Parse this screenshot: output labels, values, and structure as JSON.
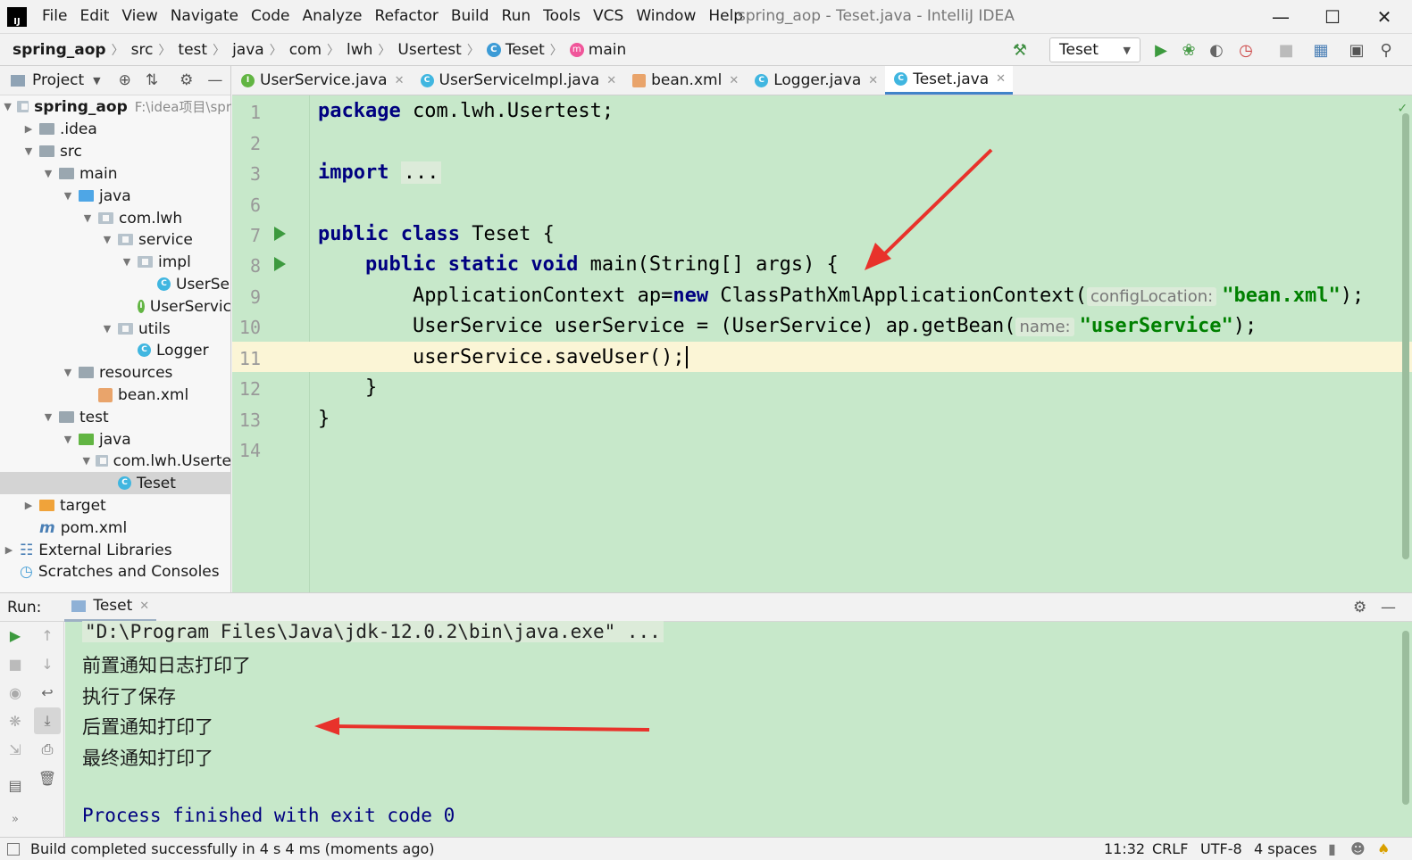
{
  "app": {
    "title": "spring_aop - Teset.java - IntelliJ IDEA"
  },
  "menu": [
    "File",
    "Edit",
    "View",
    "Navigate",
    "Code",
    "Analyze",
    "Refactor",
    "Build",
    "Run",
    "Tools",
    "VCS",
    "Window",
    "Help"
  ],
  "breadcrumb": [
    "spring_aop",
    "src",
    "test",
    "java",
    "com",
    "lwh",
    "Usertest",
    "Teset",
    "main"
  ],
  "run_config": "Teset",
  "project_panel": {
    "title": "Project",
    "tree": [
      {
        "label": "spring_aop",
        "extra": "F:\\idea项目\\spr"
      },
      {
        "label": ".idea"
      },
      {
        "label": "src"
      },
      {
        "label": "main"
      },
      {
        "label": "java"
      },
      {
        "label": "com.lwh"
      },
      {
        "label": "service"
      },
      {
        "label": "impl"
      },
      {
        "label": "UserSe"
      },
      {
        "label": "UserServic"
      },
      {
        "label": "utils"
      },
      {
        "label": "Logger"
      },
      {
        "label": "resources"
      },
      {
        "label": "bean.xml"
      },
      {
        "label": "test"
      },
      {
        "label": "java"
      },
      {
        "label": "com.lwh.Userte"
      },
      {
        "label": "Teset"
      },
      {
        "label": "target"
      },
      {
        "label": "pom.xml"
      },
      {
        "label": "External Libraries"
      },
      {
        "label": "Scratches and Consoles"
      }
    ]
  },
  "tabs": [
    "UserService.java",
    "UserServiceImpl.java",
    "bean.xml",
    "Logger.java",
    "Teset.java"
  ],
  "editor": {
    "line_numbers": [
      "1",
      "2",
      "3",
      "6",
      "7",
      "8",
      "9",
      "10",
      "11",
      "12",
      "13",
      "14"
    ],
    "code": {
      "l1_kw": "package",
      "l1_rest": " com.lwh.Usertest;",
      "l3_kw": "import",
      "l3_fold": "...",
      "l7_kw": "public class",
      "l7_rest": " Teset {",
      "l8_kw": "public static void",
      "l8_rest": " main(String[] args) {",
      "l9_a": "ApplicationContext ap=",
      "l9_kw": "new",
      "l9_b": " ClassPathXmlApplicationContext(",
      "l9_hint": "configLocation:",
      "l9_str": "\"bean.xml\"",
      "l9_c": ");",
      "l10_a": "UserService userService = (UserService) ap.getBean(",
      "l10_hint": "name:",
      "l10_str": "\"userService\"",
      "l10_c": ");",
      "l11": "userService.saveUser();",
      "l12": "}",
      "l13": "}"
    }
  },
  "run": {
    "label": "Run:",
    "tab": "Teset",
    "console": {
      "cmd": "\"D:\\Program Files\\Java\\jdk-12.0.2\\bin\\java.exe\" ...",
      "lines": [
        "前置通知日志打印了",
        "执行了保存",
        "后置通知打印了",
        "最终通知打印了"
      ],
      "exit": "Process finished with exit code 0"
    }
  },
  "status": {
    "message": "Build completed successfully in 4 s 4 ms (moments ago)",
    "position": "11:32",
    "line_sep": "CRLF",
    "encoding": "UTF-8",
    "indent": "4 spaces"
  },
  "colors": {
    "editor_bg": "#c7e8ca",
    "keyword": "#000080",
    "string": "#008000",
    "annotation_arrow": "#e8322b"
  }
}
